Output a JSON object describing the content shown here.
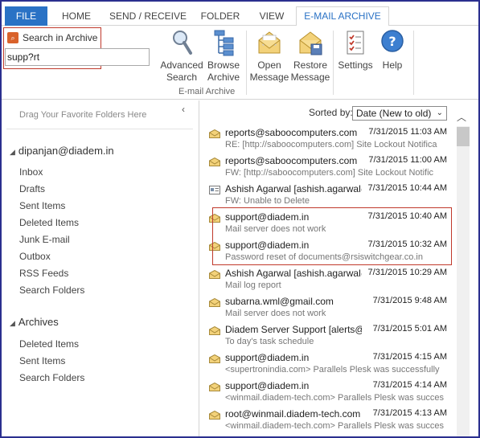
{
  "tabs": [
    "FILE",
    "HOME",
    "SEND / RECEIVE",
    "FOLDER",
    "VIEW",
    "E-MAIL ARCHIVE"
  ],
  "search": {
    "label": "Search in Archive",
    "value": "supp?rt"
  },
  "ribbon": {
    "advanced_search": [
      "Advanced",
      "Search"
    ],
    "browse_archive": [
      "Browse",
      "Archive"
    ],
    "open_message": [
      "Open",
      "Message"
    ],
    "restore_message": [
      "Restore",
      "Message"
    ],
    "settings": "Settings",
    "help": "Help",
    "group_label": "E-mail Archive"
  },
  "nav": {
    "drag_hint": "Drag Your Favorite Folders Here",
    "account": "dipanjan@diadem.in",
    "folders": [
      "Inbox",
      "Drafts",
      "Sent Items",
      "Deleted Items",
      "Junk E-mail",
      "Outbox",
      "RSS Feeds",
      "Search Folders"
    ],
    "archives_label": "Archives",
    "archive_folders": [
      "Deleted Items",
      "Sent Items",
      "Search Folders"
    ]
  },
  "list": {
    "sorted_by_label": "Sorted by:",
    "sorted_by_value": "Date (New to old)",
    "messages": [
      {
        "from": "reports@saboocomputers.com",
        "date": "7/31/2015 11:03 AM",
        "subject": "RE: [http://saboocomputers.com] Site Lockout Notifica",
        "icon": "envelope-open-icon"
      },
      {
        "from": "reports@saboocomputers.com",
        "date": "7/31/2015 11:00 AM",
        "subject": "FW: [http://saboocomputers.com] Site Lockout Notific",
        "icon": "envelope-open-icon"
      },
      {
        "from": "Ashish Agarwal [ashish.agarwal@",
        "date": "7/31/2015 10:44 AM",
        "subject": "FW: Unable to Delete",
        "icon": "contact-card-icon"
      },
      {
        "from": "support@diadem.in",
        "date": "7/31/2015 10:40 AM",
        "subject": "Mail server does not work",
        "icon": "envelope-open-icon"
      },
      {
        "from": "support@diadem.in",
        "date": "7/31/2015 10:32 AM",
        "subject": "Password reset of documents@rsiswitchgear.co.in",
        "icon": "envelope-open-icon"
      },
      {
        "from": "Ashish Agarwal [ashish.agarwal@",
        "date": "7/31/2015 10:29 AM",
        "subject": "Mail log report",
        "icon": "envelope-open-icon"
      },
      {
        "from": "subarna.wml@gmail.com",
        "date": "7/31/2015 9:48 AM",
        "subject": "Mail server does not work",
        "icon": "envelope-open-icon"
      },
      {
        "from": "Diadem Server Support [alerts@di",
        "date": "7/31/2015 5:01 AM",
        "subject": "To day's task schedule",
        "icon": "envelope-open-icon"
      },
      {
        "from": "support@diadem.in",
        "date": "7/31/2015 4:15 AM",
        "subject": "<supertronindia.com> Parallels Plesk was successfully",
        "icon": "envelope-open-icon"
      },
      {
        "from": "support@diadem.in",
        "date": "7/31/2015 4:14 AM",
        "subject": "<winmail.diadem-tech.com> Parallels Plesk was succes",
        "icon": "envelope-open-icon"
      },
      {
        "from": "root@winmail.diadem-tech.com",
        "date": "7/31/2015 4:13 AM",
        "subject": "<winmail.diadem-tech.com> Parallels Plesk was succes",
        "icon": "envelope-open-icon"
      }
    ]
  },
  "colors": {
    "accent": "#2a72c5",
    "highlight": "#c0392b",
    "frame": "#2b2f8f"
  }
}
